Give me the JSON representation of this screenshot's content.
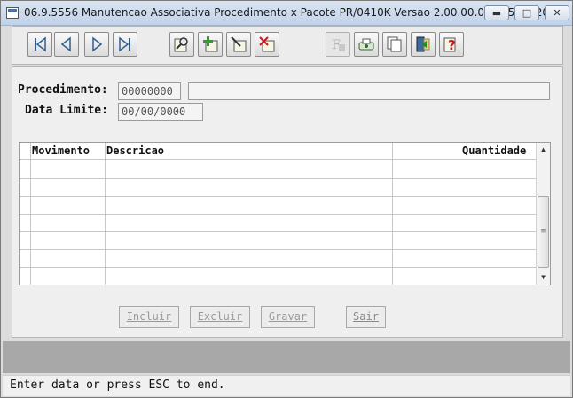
{
  "window": {
    "title": "06.9.5556 Manutencao Associativa Procedimento x Pacote PR/0410K Versao 2.00.00.007 05/10/20...",
    "min_label": "▬",
    "max_label": "□",
    "close_label": "✕"
  },
  "toolbar": {
    "buttons": [
      "first-icon",
      "prev-icon",
      "next-icon",
      "last-icon",
      "search-icon",
      "add-icon",
      "edit-icon",
      "delete-icon",
      "filter-icon",
      "print-icon",
      "copy-icon",
      "exit-icon",
      "help-icon"
    ]
  },
  "form": {
    "procedimento_label": "Procedimento:",
    "procedimento_value": "00000000",
    "procedimento_desc": "",
    "data_limite_label": "Data Limite:",
    "data_limite_value": "00/00/0000"
  },
  "grid": {
    "columns": [
      "Movimento",
      "Descricao",
      "Quantidade"
    ],
    "rows": 7
  },
  "buttons": {
    "incluir": "Incluir",
    "excluir": "Excluir",
    "gravar": "Gravar",
    "sair": "Sair"
  },
  "status": {
    "message": "Enter data or press ESC to end."
  }
}
